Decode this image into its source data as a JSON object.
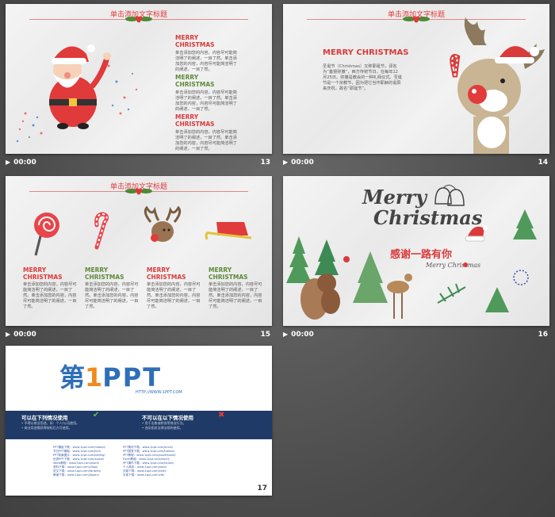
{
  "slides": [
    {
      "num": "13",
      "time": "00:00",
      "title": "单击添加文字标题",
      "sections": [
        {
          "head": "MERRY CHRISTMAS",
          "body": "单击添加您的内容，内容尽可能简洁明了的阐述，一目了然。单击添加您的内容，内容尽可能简洁明了的阐述，一目了然。"
        },
        {
          "head": "MERRY CHRISTMAS",
          "body": "单击添加您的内容，内容尽可能简洁明了的阐述，一目了然。单击添加您的内容，内容尽可能简洁明了的阐述，一目了然。"
        },
        {
          "head": "MERRY CHRISTMAS",
          "body": "单击添加您的内容，内容尽可能简洁明了的阐述，一目了然。单击添加您的内容，内容尽可能简洁明了的阐述，一目了然。"
        }
      ]
    },
    {
      "num": "14",
      "time": "00:00",
      "head": "MERRY CHRISTMAS",
      "body": "圣诞节（Christmas）又称耶诞节，译名为“基督弥撒”，西方传统节日，在每年12月25日。弥撒是教会的一种礼拜仪式。圣诞节是一个宗教节，因为把它当作耶稣的诞辰来庆祝，故名“耶诞节”。"
    },
    {
      "num": "15",
      "time": "00:00",
      "title": "单击添加文字标题",
      "columns": [
        {
          "head1": "MERRY",
          "head2": "CHRISTMAS",
          "color": "red",
          "body": "单击添加您的内容，内容尽可能简洁明了的阐述，一目了然。单击添加您的内容，内容尽可能简洁明了的阐述，一目了然。"
        },
        {
          "head1": "MERRY",
          "head2": "CHRISTMAS",
          "color": "green",
          "body": "单击添加您的内容，内容尽可能简洁明了的阐述，一目了然。单击添加您的内容，内容尽可能简洁明了的阐述，一目了然。"
        },
        {
          "head1": "MERRY",
          "head2": "CHRISTMAS",
          "color": "red",
          "body": "单击添加您的内容，内容尽可能简洁明了的阐述，一目了然。单击添加您的内容，内容尽可能简洁明了的阐述，一目了然。"
        },
        {
          "head1": "MERRY",
          "head2": "CHRISTMAS",
          "color": "green",
          "body": "单击添加您的内容，内容尽可能简洁明了的阐述，一目了然。单击添加您的内容，内容尽可能简洁明了的阐述，一目了然。"
        }
      ]
    },
    {
      "num": "16",
      "time": "00:00",
      "merry": "Merry",
      "christmas": "Christmas",
      "thanks": "感谢一路有你",
      "script": "Merry Christmas"
    },
    {
      "num": "17",
      "logo_first": "第",
      "logo_one": "1",
      "logo_ppt": "PPT",
      "logo_url": "HTTP://WWW.1PPT.COM",
      "can_title": "可以在下列情况使用",
      "can_items": [
        "• 不得以商业用途，如：个人/公司使用。",
        "• 商业用途需获得授权后方可使用。"
      ],
      "cannot_title": "不可以在以下情况使用",
      "cannot_items": [
        "• 用于出售或转卖等商业行为。",
        "• 违反相关法律法规的使用。"
      ],
      "links_left": [
        "PPT模板下载：www.1ppt.com/moban/",
        "节日PPT模板：www.1ppt.com/jieri/",
        "PPT背景图片：www.1ppt.com/beijing/",
        "优秀PPT下载：www.1ppt.com/xiazai/",
        "Word教程：www.1ppt.com/word/",
        "资料下载：www.1ppt.com/ziliao/",
        "范文下载：www.1ppt.com/fanwen/",
        "教案下载：www.1ppt.com/jiaoan/"
      ],
      "links_right": [
        "PPT素材下载：www.1ppt.com/sucai/",
        "PPT图表下载：www.1ppt.com/tubiao/",
        "PPT教程：www.1ppt.com/powerpoint/",
        "Excel教程：www.1ppt.com/excel/",
        "PPT课件下载：www.1ppt.com/kejian/",
        "个人简历：www.1ppt.com/jianli/",
        "试卷下载：www.1ppt.com/shiti/",
        "字体下载：www.1ppt.com/ziti/"
      ]
    }
  ],
  "colors": {
    "red": "#d93b3b",
    "green": "#5e8a3a",
    "navy": "#1f3a66"
  }
}
